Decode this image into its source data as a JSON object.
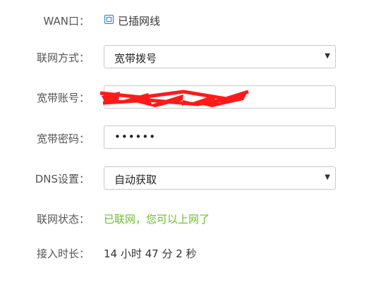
{
  "wan": {
    "label": "WAN口：",
    "status": "已插网线"
  },
  "connection_type": {
    "label": "联网方式：",
    "value": "宽带拨号",
    "arrow": "▼"
  },
  "account": {
    "label": "宽带账号："
  },
  "password": {
    "label": "宽带密码：",
    "value": "••••••"
  },
  "dns": {
    "label": "DNS设置：",
    "value": "自动获取",
    "arrow": "▼"
  },
  "net_status": {
    "label": "联网状态：",
    "value": "已联网，您可以上网了",
    "color": "#6cbf2a"
  },
  "uptime": {
    "label": "接入时长：",
    "value": "14 小时 47 分 2 秒"
  },
  "colors": {
    "redaction": "#ff1a1a",
    "checkbox": "#2a7fd4"
  }
}
